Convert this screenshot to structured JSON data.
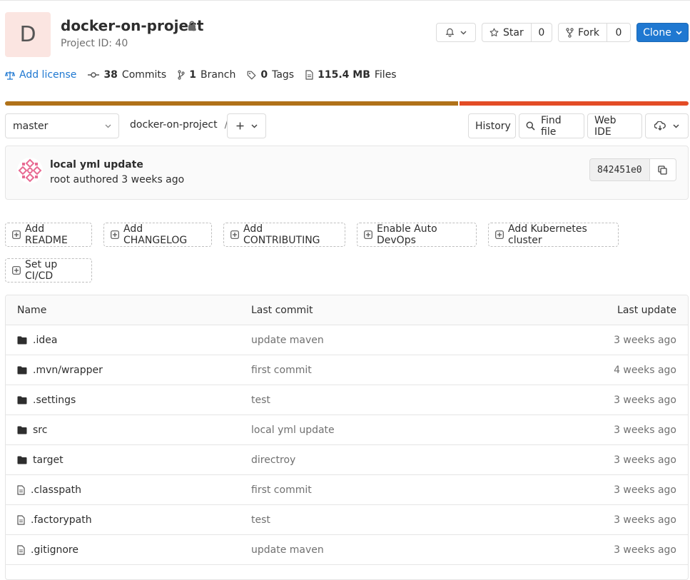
{
  "project": {
    "avatar_letter": "D",
    "name": "docker-on-project",
    "id_text": "Project ID: 40"
  },
  "header_actions": {
    "star_label": "Star",
    "star_count": "0",
    "fork_label": "Fork",
    "fork_count": "0",
    "clone_label": "Clone"
  },
  "stats": {
    "add_license": "Add license",
    "commits_count": "38",
    "commits_label": "Commits",
    "branch_count": "1",
    "branch_label": "Branch",
    "tags_count": "0",
    "tags_label": "Tags",
    "files_size": "115.4 MB",
    "files_label": "Files"
  },
  "language_bar": {
    "colors": [
      "#b07219",
      "#e34c26"
    ],
    "shares_percent": [
      66.3,
      33.7
    ]
  },
  "nav": {
    "branch": "master",
    "breadcrumb_project": "docker-on-project",
    "breadcrumb_sep": "/",
    "history": "History",
    "find_file": "Find file",
    "web_ide": "Web IDE"
  },
  "last_commit": {
    "title": "local yml update",
    "meta": "root authored 3 weeks ago",
    "sha": "842451e0"
  },
  "quick_actions": [
    "Add README",
    "Add CHANGELOG",
    "Add CONTRIBUTING",
    "Enable Auto DevOps",
    "Add Kubernetes cluster",
    "Set up CI/CD"
  ],
  "table": {
    "headers": {
      "name": "Name",
      "last_commit": "Last commit",
      "last_update": "Last update"
    },
    "rows": [
      {
        "type": "folder",
        "name": ".idea",
        "commit": "update maven",
        "updated": "3 weeks ago"
      },
      {
        "type": "folder",
        "name": ".mvn/wrapper",
        "commit": "first commit",
        "updated": "4 weeks ago"
      },
      {
        "type": "folder",
        "name": ".settings",
        "commit": "test",
        "updated": "3 weeks ago"
      },
      {
        "type": "folder",
        "name": "src",
        "commit": "local yml update",
        "updated": "3 weeks ago"
      },
      {
        "type": "folder",
        "name": "target",
        "commit": "directroy",
        "updated": "3 weeks ago"
      },
      {
        "type": "file",
        "name": ".classpath",
        "commit": "first commit",
        "updated": "3 weeks ago"
      },
      {
        "type": "file",
        "name": ".factorypath",
        "commit": "test",
        "updated": "3 weeks ago"
      },
      {
        "type": "file",
        "name": ".gitignore",
        "commit": "update maven",
        "updated": "3 weeks ago"
      }
    ]
  },
  "colors": {
    "primary": "#1f78d1",
    "avatar_bg": "#fbe5e1",
    "border": "#e5e5e5"
  }
}
